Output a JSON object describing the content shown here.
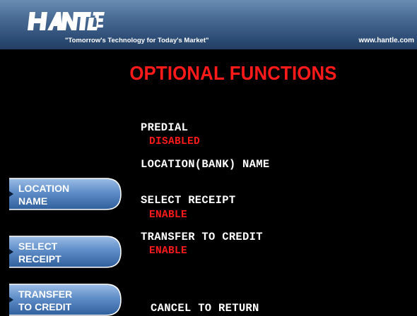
{
  "header": {
    "logo_text": "HANTLE",
    "tagline": "\"Tomorrow's Technology for Today's Market\"",
    "url": "www.hantle.com",
    "colors": {
      "bar_top": "#6a8db3",
      "bar_bottom": "#223e63",
      "logo": "#ffffff"
    }
  },
  "screen": {
    "title": "OPTIONAL FUNCTIONS",
    "title_color": "#ff1a1a"
  },
  "options": {
    "predial": {
      "label": "PREDIAL",
      "value": "DISABLED"
    },
    "location": {
      "label": "LOCATION(BANK) NAME"
    },
    "select_receipt": {
      "label": "SELECT RECEIPT",
      "value": "ENABLE"
    },
    "transfer_to_credit": {
      "label": "TRANSFER TO CREDIT",
      "value": "ENABLE"
    },
    "cancel": {
      "label": "CANCEL TO RETURN"
    }
  },
  "function_keys": {
    "location_name": {
      "line1": "LOCATION",
      "line2": "NAME"
    },
    "select_receipt": {
      "line1": "SELECT",
      "line2": "RECEIPT"
    },
    "transfer_to_credit": {
      "line1": "TRANSFER",
      "line2": "TO CREDIT"
    },
    "colors": {
      "fill_top": "#8fb2de",
      "fill_bottom": "#2f5f9c",
      "border": "#ffffff"
    }
  }
}
